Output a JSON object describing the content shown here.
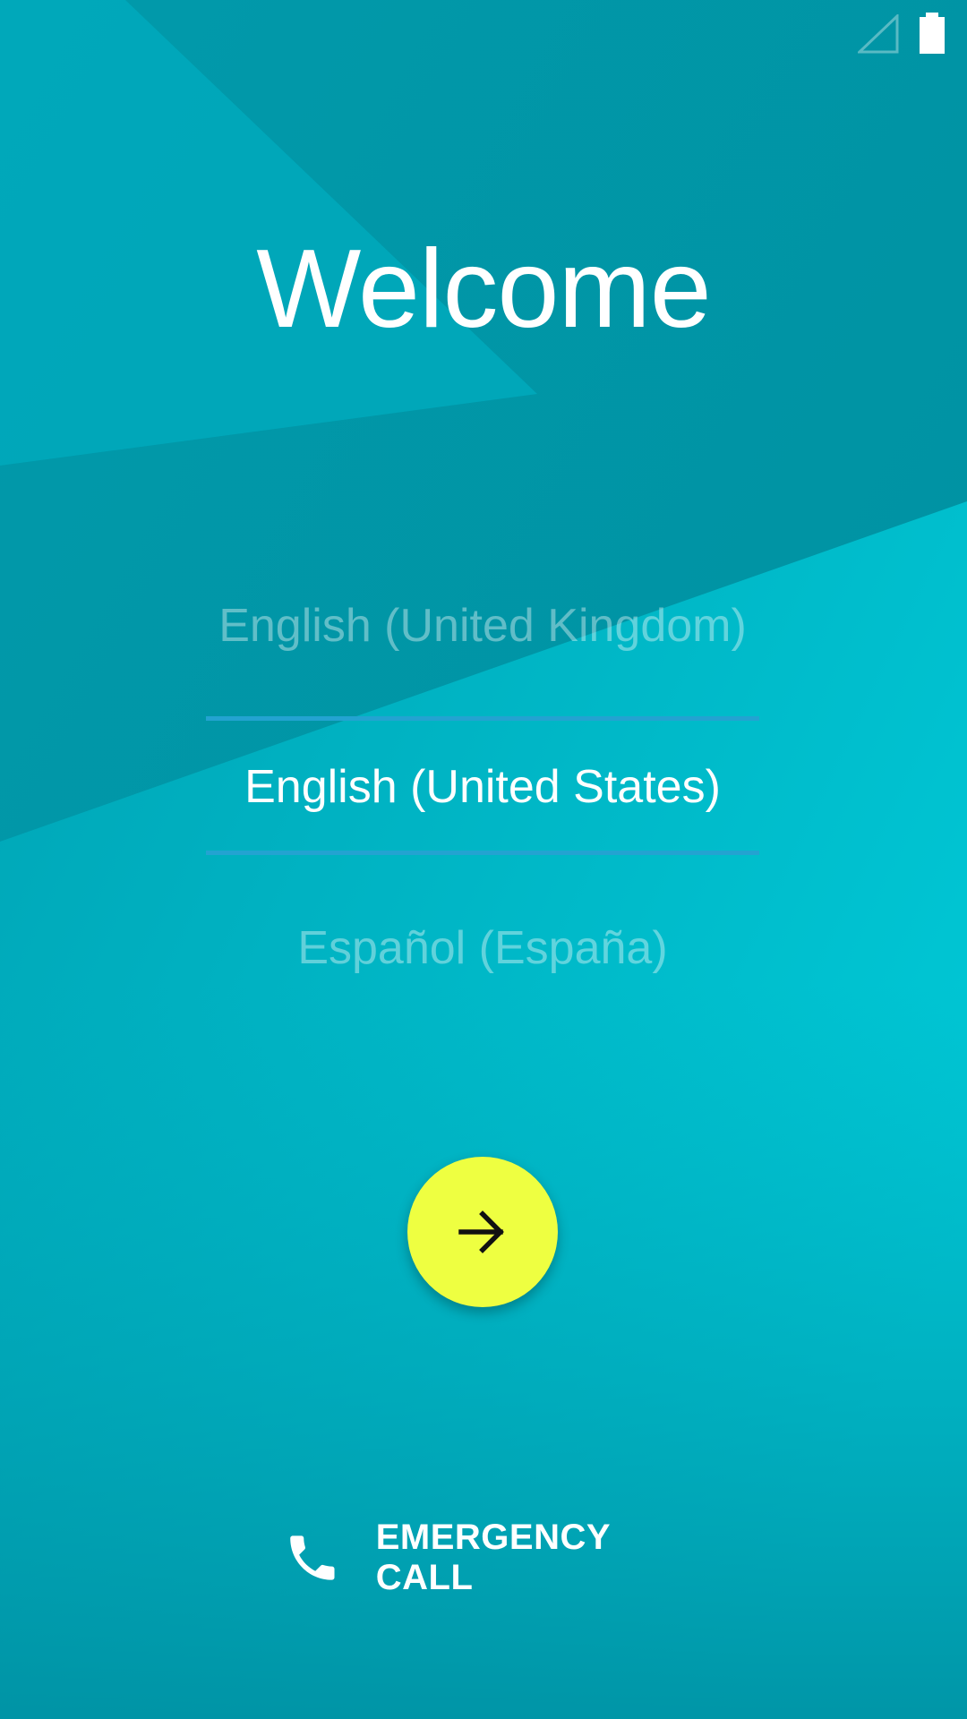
{
  "colors": {
    "background": "#0197a8",
    "accent_fab": "#eeff41",
    "divider": "#23a3d1",
    "text": "#ffffff"
  },
  "status_bar": {
    "icons": [
      "signal-icon",
      "battery-icon"
    ]
  },
  "welcome": {
    "title": "Welcome"
  },
  "language_picker": {
    "options": [
      {
        "label": "English (United Kingdom)",
        "selected": false
      },
      {
        "label": "English (United States)",
        "selected": true
      },
      {
        "label": "Español (España)",
        "selected": false
      }
    ]
  },
  "next_button": {
    "icon": "arrow-right-icon"
  },
  "emergency": {
    "label": "EMERGENCY CALL",
    "icon": "phone-icon"
  }
}
